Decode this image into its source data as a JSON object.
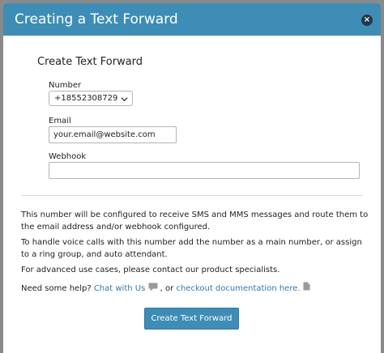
{
  "modal": {
    "title": "Creating a Text Forward",
    "close_label": "×"
  },
  "form": {
    "title": "Create Text Forward",
    "number_label": "Number",
    "number_value": "+18552308729",
    "email_label": "Email",
    "email_value": "your.email@website.com",
    "webhook_label": "Webhook",
    "webhook_value": ""
  },
  "info": {
    "para1": "This number will be configured to receive SMS and MMS messages and route them to the email address and/or webhook configured.",
    "para2": "To handle voice calls with this number add the number as a main number, or assign to a ring group, and auto attendant.",
    "para3": "For advanced use cases, please contact our product specialists.",
    "help_prefix": "Need some help? ",
    "chat_link": "Chat with Us",
    "help_sep": " , or ",
    "docs_link": "checkout documentation here."
  },
  "actions": {
    "submit_label": "Create Text Forward"
  },
  "colors": {
    "header": "#3e8db6",
    "link": "#2e79b5",
    "button": "#3e8db6"
  },
  "icons": {
    "close": "close-icon",
    "select": "chevron-down-icon",
    "chat": "chat-bubble-icon",
    "doc": "document-icon"
  }
}
